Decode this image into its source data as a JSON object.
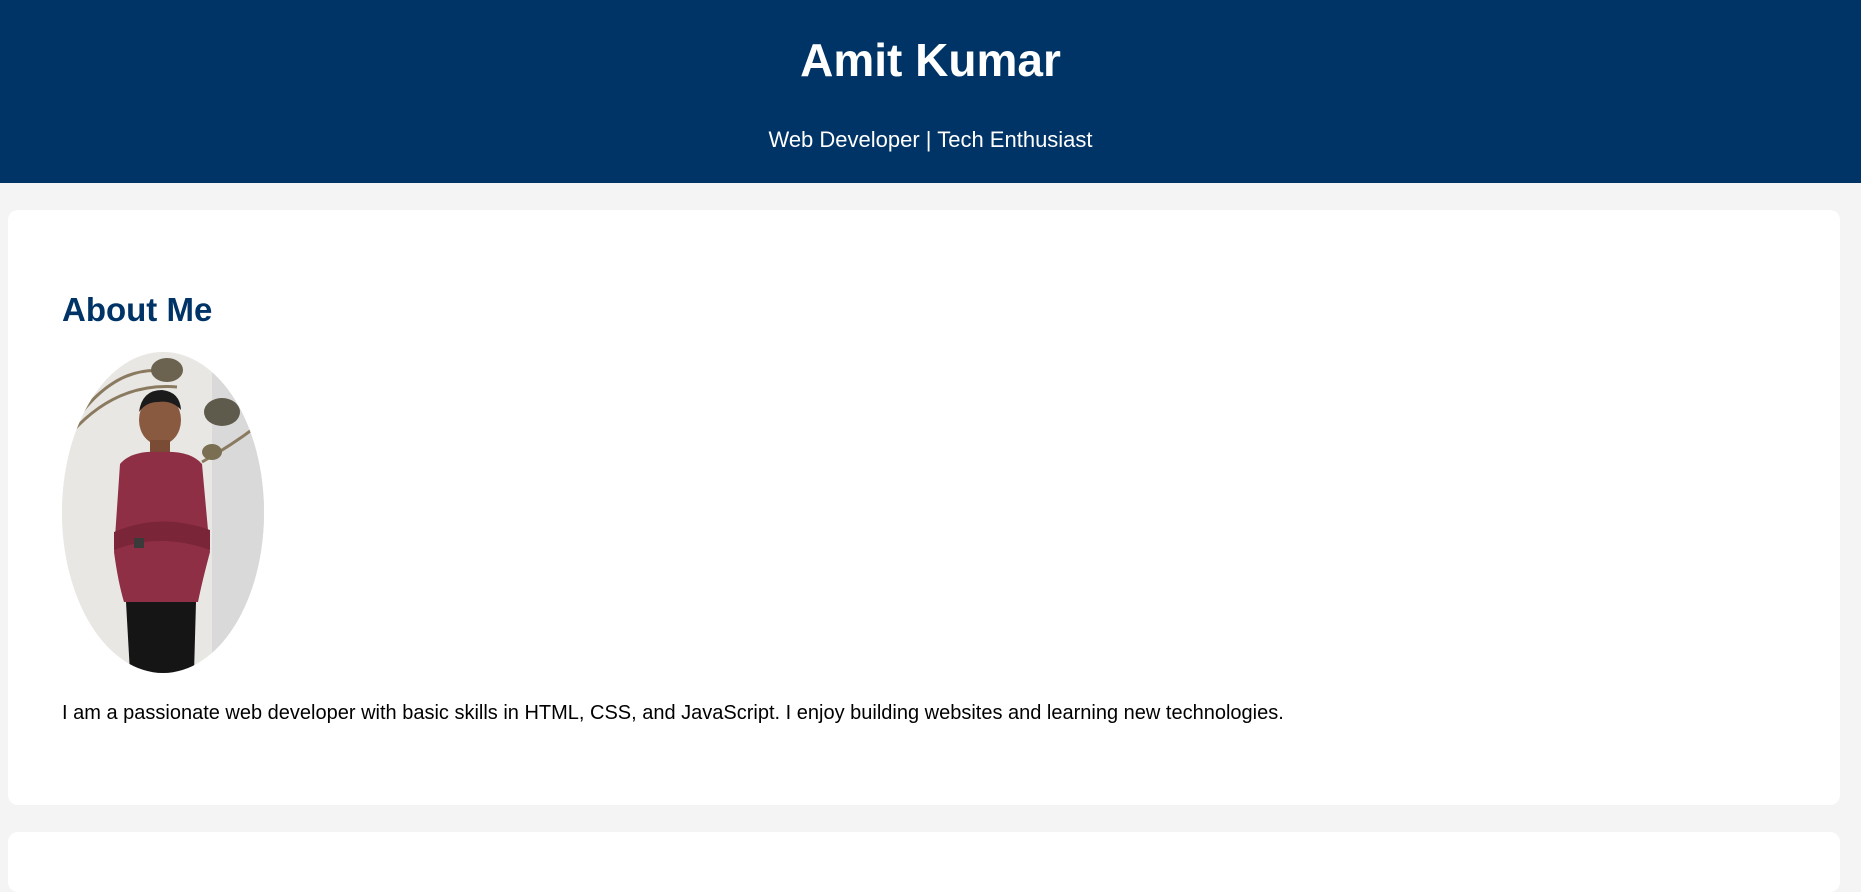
{
  "header": {
    "name": "Amit Kumar",
    "tagline": "Web Developer | Tech Enthusiast"
  },
  "about": {
    "heading": "About Me",
    "photo_alt": "Photo of Amit Kumar",
    "bio": "I am a passionate web developer with basic skills in HTML, CSS, and JavaScript. I enjoy building websites and learning new technologies."
  },
  "colors": {
    "header_bg": "#003366",
    "heading": "#003366",
    "page_bg": "#f4f4f4"
  }
}
